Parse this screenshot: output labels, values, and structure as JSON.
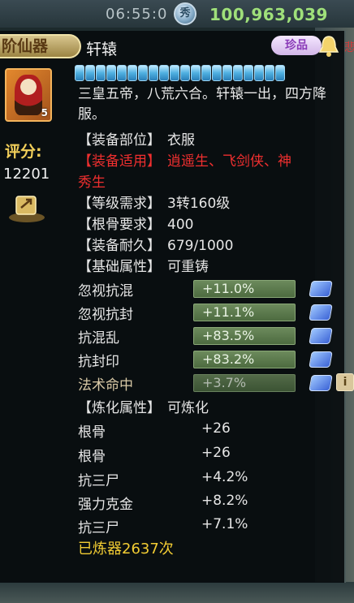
{
  "status_bar": {
    "time": "06:55:0",
    "currency_icon_glyph": "秀",
    "currency_value": "100,963,039"
  },
  "item": {
    "tier_label": "阶仙器",
    "name": "轩辕",
    "rarity_label": "珍品",
    "edge_text": "悲",
    "slot_level": "5",
    "score_label": "评分:",
    "score_value": "12201",
    "durability_segments": 20,
    "description": "三皇五帝，八荒六合。轩辕一出，四方降服。",
    "fields": [
      {
        "key": "【装备部位】",
        "value": "衣服",
        "style": "normal"
      },
      {
        "key": "【装备适用】",
        "value": "逍遥生、飞剑侠、神",
        "style": "red"
      },
      {
        "key": "",
        "value": "秀生",
        "style": "red-cont"
      },
      {
        "key": "【等级需求】",
        "value": "3转160级",
        "style": "normal"
      },
      {
        "key": "【根骨要求】",
        "value": "400",
        "style": "normal"
      },
      {
        "key": "【装备耐久】",
        "value": "679/1000",
        "style": "normal"
      },
      {
        "key": "【基础属性】",
        "value": "可重铸",
        "style": "normal"
      }
    ],
    "base_attributes": [
      {
        "name": "忽视抗混",
        "value": "+11.0%",
        "dim": false
      },
      {
        "name": "忽视抗封",
        "value": "+11.1%",
        "dim": false
      },
      {
        "name": "抗混乱",
        "value": "+83.5%",
        "dim": false
      },
      {
        "name": "抗封印",
        "value": "+83.2%",
        "dim": false
      },
      {
        "name": "法术命中",
        "value": "+3.7%",
        "dim": true
      }
    ],
    "refine_header": {
      "key": "【炼化属性】",
      "value": "可炼化"
    },
    "refine_attributes": [
      {
        "name": "根骨",
        "value": "+26"
      },
      {
        "name": "根骨",
        "value": "+26"
      },
      {
        "name": "抗三尸",
        "value": "+4.2%"
      },
      {
        "name": "强力克金",
        "value": "+8.2%"
      },
      {
        "name": "抗三尸",
        "value": "+7.1%"
      }
    ],
    "refine_count": "已炼器2637次",
    "info_icon_glyph": "i"
  },
  "colors": {
    "red_text": "#ef2f2f",
    "gold_text": "#f2cc33",
    "currency_green": "#9fe07a",
    "attr_bar": "#5d7b4e"
  }
}
